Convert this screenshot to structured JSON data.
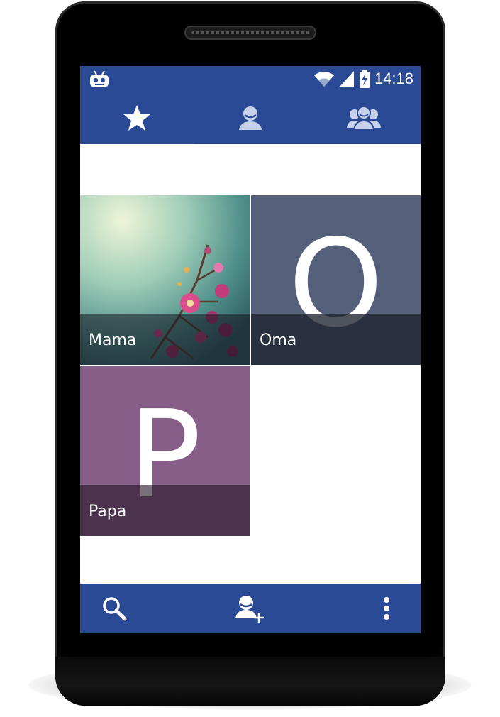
{
  "status_bar": {
    "time": "14:18",
    "icons": [
      "cyanogenmod-icon",
      "wifi-icon",
      "signal-icon",
      "battery-charging-icon"
    ]
  },
  "tabs": [
    {
      "icon": "star-icon",
      "label": "Favorites",
      "selected": true
    },
    {
      "icon": "person-icon",
      "label": "Contacts",
      "selected": false
    },
    {
      "icon": "group-icon",
      "label": "Groups",
      "selected": false
    }
  ],
  "favorites": [
    {
      "name": "Mama",
      "letter": "",
      "type": "photo",
      "color": "#6fa89a"
    },
    {
      "name": "Oma",
      "letter": "O",
      "type": "letter",
      "color": "#55607a"
    },
    {
      "name": "Papa",
      "letter": "P",
      "type": "letter",
      "color": "#875e87"
    }
  ],
  "bottom_bar": {
    "icons": [
      "search-icon",
      "add-contact-icon",
      "overflow-menu-icon"
    ]
  },
  "colors": {
    "primary": "#2b4a96",
    "screen_bg": "#ffffff"
  }
}
